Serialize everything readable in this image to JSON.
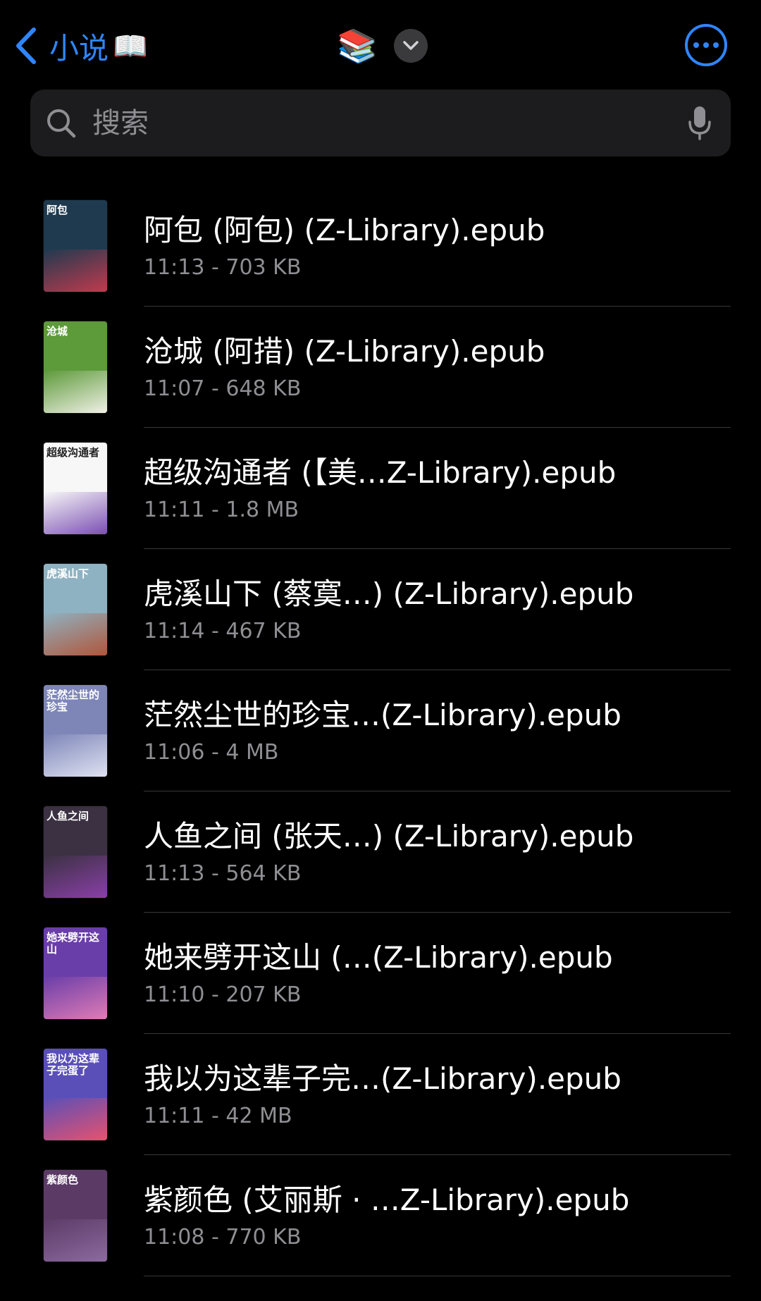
{
  "nav": {
    "back_label": "小说",
    "back_emoji": "📖",
    "center_emoji": "📚",
    "accent_color": "#2f86ff"
  },
  "search": {
    "placeholder": "搜索",
    "value": ""
  },
  "files": [
    {
      "name": "阿包 (阿包) (Z-Library).epub",
      "meta": "11:13 - 703 KB",
      "cover_title": "阿包",
      "cover_bg": "#1f3a4f",
      "cover_accent": "#c23a4e"
    },
    {
      "name": "沧城 (阿措) (Z-Library).epub",
      "meta": "11:07 - 648 KB",
      "cover_title": "沧城",
      "cover_bg": "#5d9a3a",
      "cover_accent": "#f0f0e6"
    },
    {
      "name": "超级沟通者 (【美…Z-Library).epub",
      "meta": "11:11 - 1.8 MB",
      "cover_title": "超级沟通者",
      "cover_bg": "#f7f7f7",
      "cover_accent": "#7b4fb3"
    },
    {
      "name": "虎溪山下 (蔡寞…) (Z-Library).epub",
      "meta": "11:14 - 467 KB",
      "cover_title": "虎溪山下",
      "cover_bg": "#8fb2c2",
      "cover_accent": "#b0563a"
    },
    {
      "name": "茫然尘世的珍宝…(Z-Library).epub",
      "meta": "11:06 - 4 MB",
      "cover_title": "茫然尘世的珍宝",
      "cover_bg": "#7e86b8",
      "cover_accent": "#dfe2f2"
    },
    {
      "name": "人鱼之间 (张天…) (Z-Library).epub",
      "meta": "11:13 - 564 KB",
      "cover_title": "人鱼之间",
      "cover_bg": "#3b3142",
      "cover_accent": "#8a3fa8"
    },
    {
      "name": "她来劈开这山 (…(Z-Library).epub",
      "meta": "11:10 - 207 KB",
      "cover_title": "她来劈开这山",
      "cover_bg": "#6a3ea8",
      "cover_accent": "#e07bb6"
    },
    {
      "name": "我以为这辈子完…(Z-Library).epub",
      "meta": "11:11 - 42 MB",
      "cover_title": "我以为这辈子完蛋了",
      "cover_bg": "#5a4fb8",
      "cover_accent": "#e6526e"
    },
    {
      "name": "紫颜色 (艾丽斯 · …Z-Library).epub",
      "meta": "11:08 - 770 KB",
      "cover_title": "紫颜色",
      "cover_bg": "#5b3b66",
      "cover_accent": "#8c6aa0"
    }
  ]
}
